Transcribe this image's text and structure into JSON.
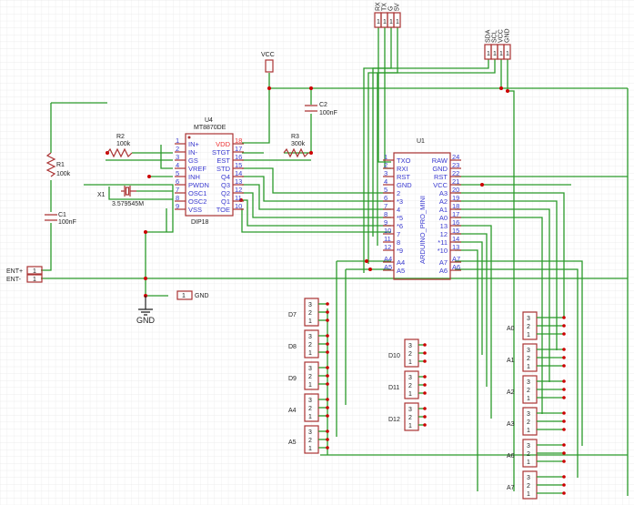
{
  "colors": {
    "wire": "#2a9a2a",
    "part": "#aa3333",
    "pin_text": "#3a3ad0",
    "junction": "#cc0000"
  },
  "u4": {
    "ref": "U4",
    "value": "MT8870DE",
    "package": "DIP18",
    "left_pins": [
      [
        "1",
        "IN+"
      ],
      [
        "2",
        "IN-"
      ],
      [
        "3",
        "GS"
      ],
      [
        "4",
        "VREF"
      ],
      [
        "5",
        "INH"
      ],
      [
        "6",
        "PWDN"
      ],
      [
        "7",
        "OSC1"
      ],
      [
        "8",
        "OSC2"
      ],
      [
        "9",
        "VSS"
      ]
    ],
    "right_pins": [
      [
        "18",
        "VDD"
      ],
      [
        "17",
        "STGT"
      ],
      [
        "16",
        "EST"
      ],
      [
        "15",
        "STD"
      ],
      [
        "14",
        "Q4"
      ],
      [
        "13",
        "Q3"
      ],
      [
        "12",
        "Q2"
      ],
      [
        "11",
        "Q1"
      ],
      [
        "10",
        "TOE"
      ]
    ]
  },
  "u1": {
    "ref": "U1",
    "value": "ARDUINO_PRO_MINI",
    "left_pins": [
      [
        "1",
        "TXO"
      ],
      [
        "2",
        "RXI"
      ],
      [
        "3",
        "RST"
      ],
      [
        "4",
        "GND"
      ],
      [
        "5",
        "2"
      ],
      [
        "6",
        "*3"
      ],
      [
        "7",
        "4"
      ],
      [
        "8",
        "*5"
      ],
      [
        "9",
        "*6"
      ],
      [
        "10",
        "7"
      ],
      [
        "11",
        "8"
      ],
      [
        "12",
        "*9"
      ],
      [
        "A4",
        "A4"
      ],
      [
        "A5",
        "A5"
      ]
    ],
    "right_pins": [
      [
        "24",
        "RAW"
      ],
      [
        "23",
        "GND"
      ],
      [
        "22",
        "RST"
      ],
      [
        "21",
        "VCC"
      ],
      [
        "20",
        "A3"
      ],
      [
        "19",
        "A2"
      ],
      [
        "18",
        "A1"
      ],
      [
        "17",
        "A0"
      ],
      [
        "16",
        "13"
      ],
      [
        "15",
        "12"
      ],
      [
        "14",
        "*11"
      ],
      [
        "13",
        "*10"
      ],
      [
        "A7",
        "A7"
      ],
      [
        "A6",
        "A6"
      ]
    ]
  },
  "r1": {
    "ref": "R1",
    "value": "100k"
  },
  "r2": {
    "ref": "R2",
    "value": "100k"
  },
  "r3": {
    "ref": "R3",
    "value": "300k"
  },
  "c1": {
    "ref": "C1",
    "value": "100nF"
  },
  "c2": {
    "ref": "C2",
    "value": "100nF"
  },
  "x1": {
    "ref": "X1",
    "value": "3.579545M"
  },
  "vcc_label": "VCC",
  "gnd_symbol": "GND",
  "gnd_connector": {
    "pin": "1",
    "label": "GND"
  },
  "ent": [
    {
      "pin": "1",
      "label": "ENT+"
    },
    {
      "pin": "1",
      "label": "ENT-"
    }
  ],
  "serial_header": {
    "pins": [
      "1",
      "1",
      "1",
      "1"
    ],
    "labels": [
      "RX",
      "TX",
      "G",
      "5V"
    ]
  },
  "i2c_header": {
    "pins": [
      "1",
      "1",
      "1",
      "1"
    ],
    "labels": [
      "SDA",
      "SCL",
      "VCC",
      "GND"
    ]
  },
  "servo_left": [
    {
      "label": "D7"
    },
    {
      "label": "D8"
    },
    {
      "label": "D9"
    },
    {
      "label": "A4"
    },
    {
      "label": "A5"
    }
  ],
  "servo_mid": [
    {
      "label": "D10"
    },
    {
      "label": "D11"
    },
    {
      "label": "D12"
    }
  ],
  "servo_right": [
    {
      "label": "A0"
    },
    {
      "label": "A1"
    },
    {
      "label": "A2"
    },
    {
      "label": "A3"
    },
    {
      "label": "A6"
    },
    {
      "label": "A7"
    }
  ],
  "servo_pins": [
    "3",
    "2",
    "1"
  ]
}
